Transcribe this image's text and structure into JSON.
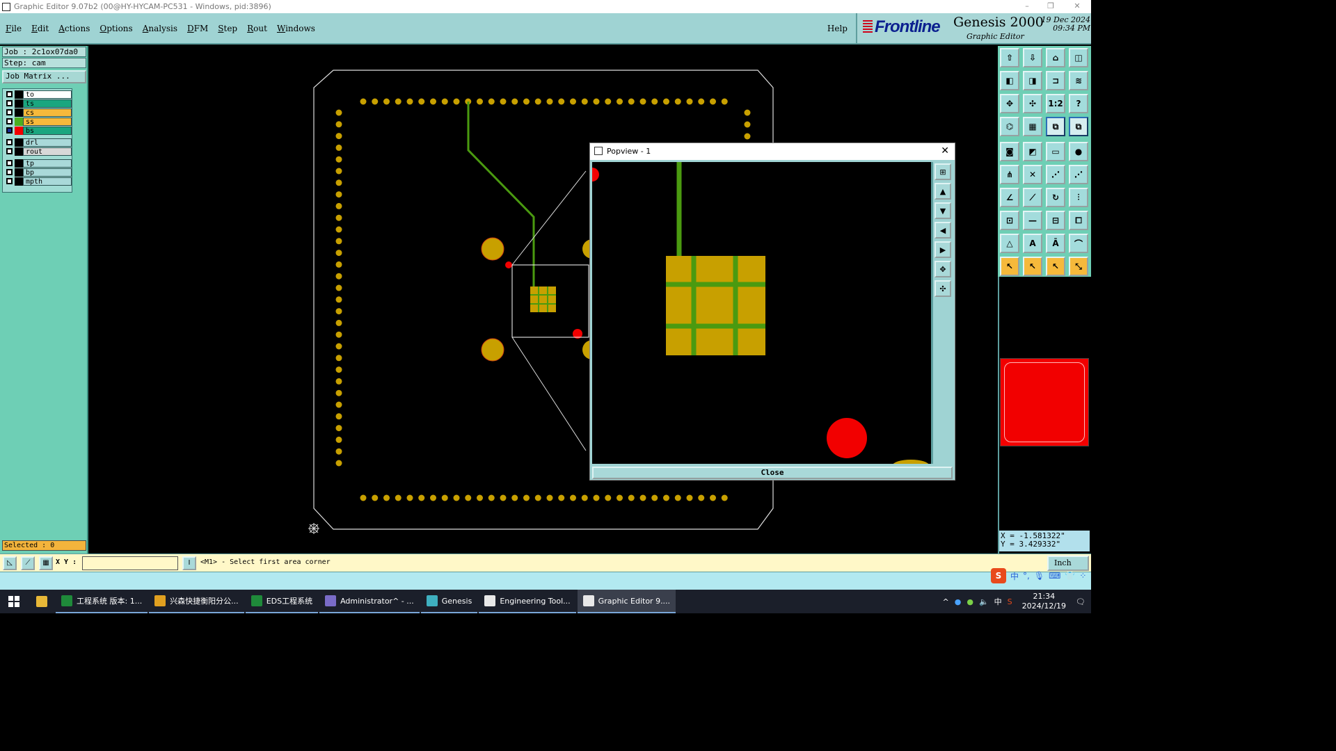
{
  "window": {
    "title": "Graphic Editor 9.07b2 (00@HY-HYCAM-PC531 - Windows, pid:3896)",
    "minimize": "–",
    "restore": "❐",
    "close": "✕"
  },
  "menu": {
    "items": [
      "File",
      "Edit",
      "Actions",
      "Options",
      "Analysis",
      "DFM",
      "Step",
      "Rout",
      "Windows"
    ],
    "help": "Help"
  },
  "brand": {
    "logo": "Frontline",
    "product": "Genesis 2000",
    "subtitle": "Graphic Editor",
    "date_line1": "19 Dec 2024",
    "date_line2": "09:34 PM"
  },
  "left_panel": {
    "job": "Job : 2c1ox07da0",
    "step": "Step: cam",
    "job_matrix": "Job Matrix ...",
    "layers": [
      {
        "name": "to",
        "color": "#ffffff",
        "swatch": "#000000",
        "checked": false
      },
      {
        "name": "ts",
        "color": "#1aa67f",
        "swatch": "#000000",
        "checked": false
      },
      {
        "name": "cs",
        "color": "#f6b93b",
        "swatch": "#000000",
        "checked": false
      },
      {
        "name": "ss",
        "color": "#f6b93b",
        "swatch": "#4caf20",
        "checked": false
      },
      {
        "name": "bs",
        "color": "#1aa67f",
        "swatch": "#f20000",
        "checked": true
      },
      {
        "name": "drl",
        "color": "#a9d9d9",
        "swatch": "#000000",
        "checked": false
      },
      {
        "name": "rout",
        "color": "#d8d8d8",
        "swatch": "#000000",
        "checked": false
      },
      {
        "name": "tp",
        "color": "#a9d9d9",
        "swatch": "#000000",
        "checked": false
      },
      {
        "name": "bp",
        "color": "#a9d9d9",
        "swatch": "#000000",
        "checked": false
      },
      {
        "name": "mpth",
        "color": "#a9d9d9",
        "swatch": "#000000",
        "checked": false
      }
    ],
    "selected": "Selected : 0"
  },
  "colors": {
    "pad": "#c8a000",
    "trace": "#4a9a10",
    "red": "#f20000",
    "outline": "#dddddd"
  },
  "popview": {
    "title": "Popview - 1",
    "close_x": "✕",
    "close_button": "Close"
  },
  "coords": {
    "x": "X = -1.581322\"",
    "y": "Y = 3.429332\""
  },
  "status": {
    "xy_label": "X Y :",
    "xy_value": "",
    "prompt": "<M1> - Select first area corner",
    "units": "Inch"
  },
  "ime": {
    "lang": "中",
    "punct": "°,"
  },
  "taskbar": {
    "items": [
      {
        "label": "工程系统  版本: 1...",
        "color": "#1f8a3a",
        "active": false
      },
      {
        "label": "兴森快捷衡阳分公...",
        "color": "#e0a020",
        "active": false
      },
      {
        "label": "EDS工程系统",
        "color": "#1f8a3a",
        "active": false
      },
      {
        "label": "Administrator^ - ...",
        "color": "#7a6cc8",
        "active": false
      },
      {
        "label": "Genesis",
        "color": "#3fb0c0",
        "active": false
      },
      {
        "label": "Engineering Tool...",
        "color": "#e8e8e8",
        "active": false
      },
      {
        "label": "Graphic Editor 9....",
        "color": "#e8e8e8",
        "active": true
      }
    ],
    "tray_lang": "中",
    "time": "21:34",
    "date": "2024/12/19"
  }
}
